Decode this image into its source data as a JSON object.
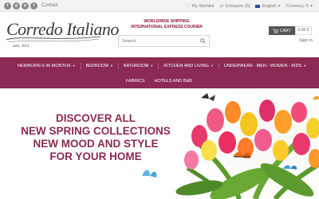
{
  "topbar": {
    "contact": "Contact",
    "social": [
      {
        "name": "facebook-icon",
        "glyph": "f"
      },
      {
        "name": "google-plus-icon",
        "glyph": "g"
      },
      {
        "name": "pinterest-icon",
        "glyph": "p"
      },
      {
        "name": "twitter-icon",
        "glyph": "t"
      }
    ],
    "wishlist": "My Wishlist",
    "compare": "Compare (0)",
    "language": "English",
    "currency": "Currency: € "
  },
  "logo": {
    "text": "Corredo Italiano",
    "estd": "estd. 2014"
  },
  "shipping": {
    "line1": "WORLDWIDE SHIPPING",
    "line2": "INTERNATIONAL EXPRESS COURIER"
  },
  "search": {
    "placeholder": "Search"
  },
  "cart": {
    "label": "CART",
    "amount": "0.00 €"
  },
  "account": {
    "signin": "Sign in"
  },
  "nav": {
    "row1": [
      "NEWBORN 0-36 MONTHS",
      "BEDROOM",
      "BATHROOM",
      "KITCHEN AND LIVING",
      "UNDERWEAR - MEN - WOMEN - KIDS"
    ],
    "row2": [
      "FABRICS",
      "HOTELS AND B&B"
    ]
  },
  "banner": {
    "line1": "DISCOVER ALL",
    "line2": "NEW SPRING COLLECTIONS",
    "line3": "NEW MOOD AND STYLE",
    "line4": "FOR YOUR HOME"
  },
  "colors": {
    "brand": "#8b2a52",
    "shipping_text": "#8b1a3b"
  }
}
